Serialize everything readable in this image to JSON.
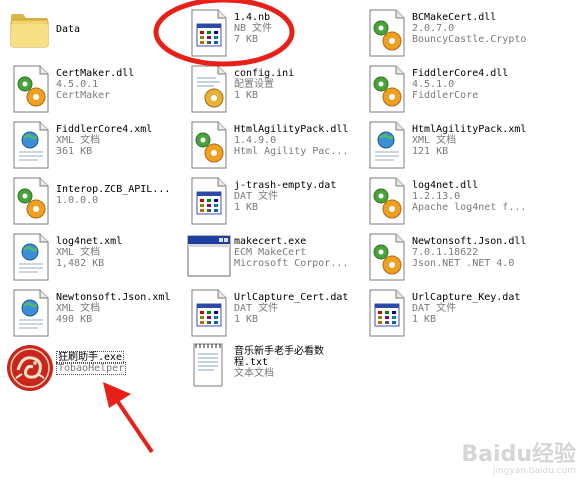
{
  "files": [
    {
      "name": "Data",
      "icon": "folder-icon",
      "lines": []
    },
    {
      "name": "1.4.nb",
      "icon": "nb-file-icon",
      "lines": [
        "NB 文件",
        "7 KB"
      ]
    },
    {
      "name": "BCMakeCert.dll",
      "icon": "dll-icon",
      "lines": [
        "2.0.7.0",
        "BouncyCastle.Crypto"
      ]
    },
    {
      "name": "CertMaker.dll",
      "icon": "dll-icon",
      "lines": [
        "4.5.0.1",
        "CertMaker"
      ]
    },
    {
      "name": "config.ini",
      "icon": "ini-icon",
      "lines": [
        "配置设置",
        "1 KB"
      ]
    },
    {
      "name": "FiddlerCore4.dll",
      "icon": "dll-icon",
      "lines": [
        "4.5.1.0",
        "FiddlerCore"
      ]
    },
    {
      "name": "FiddlerCore4.xml",
      "icon": "xml-icon",
      "lines": [
        "XML 文档",
        "361 KB"
      ]
    },
    {
      "name": "HtmlAgilityPack.dll",
      "icon": "dll-icon",
      "lines": [
        "1.4.9.0",
        "Html Agility Pac..."
      ]
    },
    {
      "name": "HtmlAgilityPack.xml",
      "icon": "xml-icon",
      "lines": [
        "XML 文档",
        "121 KB"
      ]
    },
    {
      "name": "Interop.ZCB_APIL...",
      "icon": "dll-icon",
      "lines": [
        "1.0.0.0"
      ]
    },
    {
      "name": "j-trash-empty.dat",
      "icon": "dat-icon",
      "lines": [
        "DAT 文件",
        "1 KB"
      ]
    },
    {
      "name": "log4net.dll",
      "icon": "dll-icon",
      "lines": [
        "1.2.13.0",
        "Apache log4net f..."
      ]
    },
    {
      "name": "log4net.xml",
      "icon": "xml-icon",
      "lines": [
        "XML 文档",
        "1,482 KB"
      ]
    },
    {
      "name": "makecert.exe",
      "icon": "exe-window-icon",
      "lines": [
        "ECM MakeCert",
        "Microsoft Corpor..."
      ]
    },
    {
      "name": "Newtonsoft.Json.dll",
      "icon": "dll-icon",
      "lines": [
        "7.0.1.18622",
        "Json.NET .NET 4.0"
      ]
    },
    {
      "name": "Newtonsoft.Json.xml",
      "icon": "xml-icon",
      "lines": [
        "XML 文档",
        "490 KB"
      ]
    },
    {
      "name": "UrlCapture_Cert.dat",
      "icon": "dat-icon",
      "lines": [
        "DAT 文件",
        "1 KB"
      ]
    },
    {
      "name": "UrlCapture_Key.dat",
      "icon": "dat-icon",
      "lines": [
        "DAT 文件",
        "1 KB"
      ]
    },
    {
      "name": "狂刷助手.exe",
      "icon": "dragon-app-icon",
      "lines": [
        "TobaoHelper"
      ]
    },
    {
      "name": "音乐新手老手必看数程.txt",
      "icon": "txt-icon",
      "lines": [
        "文本文档"
      ]
    }
  ],
  "watermark": {
    "main": "Baidu经验",
    "sub": "jingyan.baidu.com"
  },
  "colors": {
    "annotation": "#e8201a",
    "dragon": "#c8261c"
  }
}
